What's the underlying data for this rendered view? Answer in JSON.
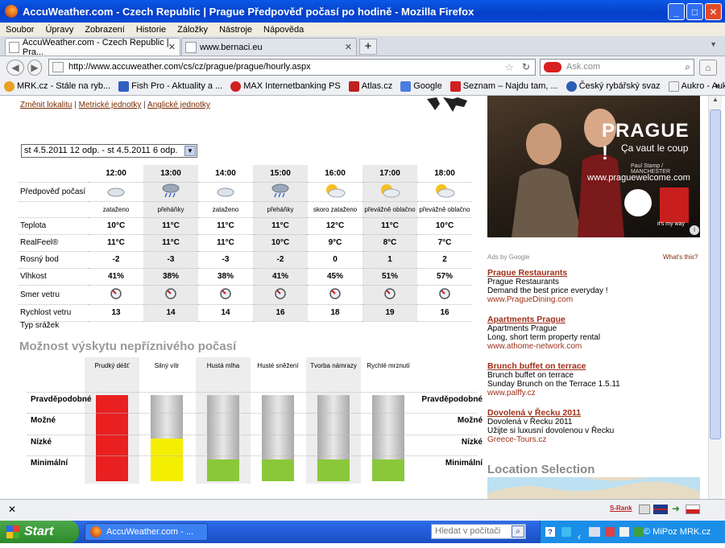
{
  "window": {
    "title": "AccuWeather.com - Czech Republic | Prague Předpověď počasí po hodině - Mozilla Firefox"
  },
  "menu": [
    "Soubor",
    "Úpravy",
    "Zobrazení",
    "Historie",
    "Záložky",
    "Nástroje",
    "Nápověda"
  ],
  "tabs": [
    {
      "label": "AccuWeather.com - Czech Republic | Pra..."
    },
    {
      "label": "www.bernaci.eu"
    }
  ],
  "nav": {
    "url": "http://www.accuweather.com/cs/cz/prague/prague/hourly.aspx",
    "search_placeholder": "Ask.com"
  },
  "bookmarks": [
    {
      "label": "MRK.cz - Stále na ryb...",
      "color": "#e8a020"
    },
    {
      "label": "Fish Pro - Aktuality a ...",
      "color": "#3060c0"
    },
    {
      "label": "MAX Internetbanking PS",
      "color": "#d02020"
    },
    {
      "label": "Atlas.cz",
      "color": "#c02020"
    },
    {
      "label": "Google",
      "color": "#4a7de0"
    },
    {
      "label": "Seznam – Najdu tam, ...",
      "color": "#d02020"
    },
    {
      "label": "Český rybářský svaz",
      "color": "#2a60b0"
    },
    {
      "label": "Aukro - Aukce OnLine",
      "color": "#f0f0f0"
    }
  ],
  "page": {
    "links": [
      "Změnit lokalitu",
      "Metrické jednotky",
      "Anglické jednotky"
    ],
    "date_select": "st 4.5.2011 12 odp. - st 4.5.2011 6 odp.",
    "forecast": {
      "row_labels": {
        "forecast": "Předpověď počasí",
        "temp": "Teplota",
        "realfeel": "RealFeel®",
        "dew": "Rosný bod",
        "humidity": "Vlhkost",
        "wind_dir": "Smer vetru",
        "wind_speed": "Rychlost vetru",
        "precip": "Typ srážek"
      },
      "hours": [
        "12:00",
        "13:00",
        "14:00",
        "15:00",
        "16:00",
        "17:00",
        "18:00"
      ],
      "icons": [
        "cloudy-icon",
        "showers-icon",
        "cloudy-icon",
        "showers-icon",
        "partly-sunny-icon",
        "partly-sunny-icon",
        "partly-sunny-icon"
      ],
      "conditions": [
        "zataženo",
        "přeháňky",
        "zataženo",
        "přeháňky",
        "skoro zataženo",
        "převážně oblačno",
        "převážně oblačno"
      ],
      "temp": [
        "10°C",
        "11°C",
        "11°C",
        "11°C",
        "12°C",
        "11°C",
        "10°C"
      ],
      "realfeel": [
        "11°C",
        "11°C",
        "11°C",
        "10°C",
        "9°C",
        "8°C",
        "7°C"
      ],
      "dew": [
        "-2",
        "-3",
        "-3",
        "-2",
        "0",
        "1",
        "2"
      ],
      "humidity": [
        "41%",
        "38%",
        "38%",
        "41%",
        "45%",
        "51%",
        "57%"
      ],
      "wind_speed": [
        "13",
        "14",
        "14",
        "16",
        "18",
        "19",
        "16"
      ]
    },
    "risk": {
      "title": "Možnost výskytu nepříznivého počasí",
      "levels": [
        "Pravděpodobné",
        "Možné",
        "Nízké",
        "Minimální"
      ],
      "columns": [
        {
          "label": "Prudký déšť",
          "level": 4,
          "color": "#e82020"
        },
        {
          "label": "Silný vítr",
          "level": 2,
          "color": "#f4ee00"
        },
        {
          "label": "Hustá mlha",
          "level": 1,
          "color": "#8ac83a"
        },
        {
          "label": "Husté sněžení",
          "level": 1,
          "color": "#8ac83a"
        },
        {
          "label": "Tvorba námrazy",
          "level": 1,
          "color": "#8ac83a"
        },
        {
          "label": "Rychlé mrznutí",
          "level": 1,
          "color": "#8ac83a"
        }
      ]
    },
    "ad_image": {
      "headline": "PRAGUE !",
      "sub": "Ça vaut le coup",
      "credit": "Paul Stamp / MANCHESTER",
      "url": "www.praguewelcome.com",
      "tag": "it's my way"
    },
    "ads_by": "Ads by Google",
    "whats_this": "What's this?",
    "ads": [
      {
        "title": "Prague Restaurants",
        "line1": "Prague Restaurants",
        "line2": "Demand the best price everyday !",
        "url": "www.PragueDining.com"
      },
      {
        "title": "Apartments Prague",
        "line1": "Apartments Prague",
        "line2": "Long, short term property rental",
        "url": "www.athome-network.com"
      },
      {
        "title": "Brunch buffet on terrace",
        "line1": "Brunch buffet on terrace",
        "line2": "Sunday Brunch on the Terrace 1.5.11",
        "url": "www.palffy.cz"
      },
      {
        "title": "Dovolená v Řecku 2011",
        "line1": "Dovolená v Řecku 2011",
        "line2": "Užijte si luxusní dovolenou v Řecku",
        "url": "Greece-Tours.cz"
      }
    ],
    "location_selection": "Location Selection"
  },
  "status": {
    "srank": "S-Rank"
  },
  "taskbar": {
    "start": "Start",
    "task": "AccuWeather.com - ...",
    "search": "Hledat v počítači",
    "tray_text": "© MiPoz MRK.cz"
  }
}
